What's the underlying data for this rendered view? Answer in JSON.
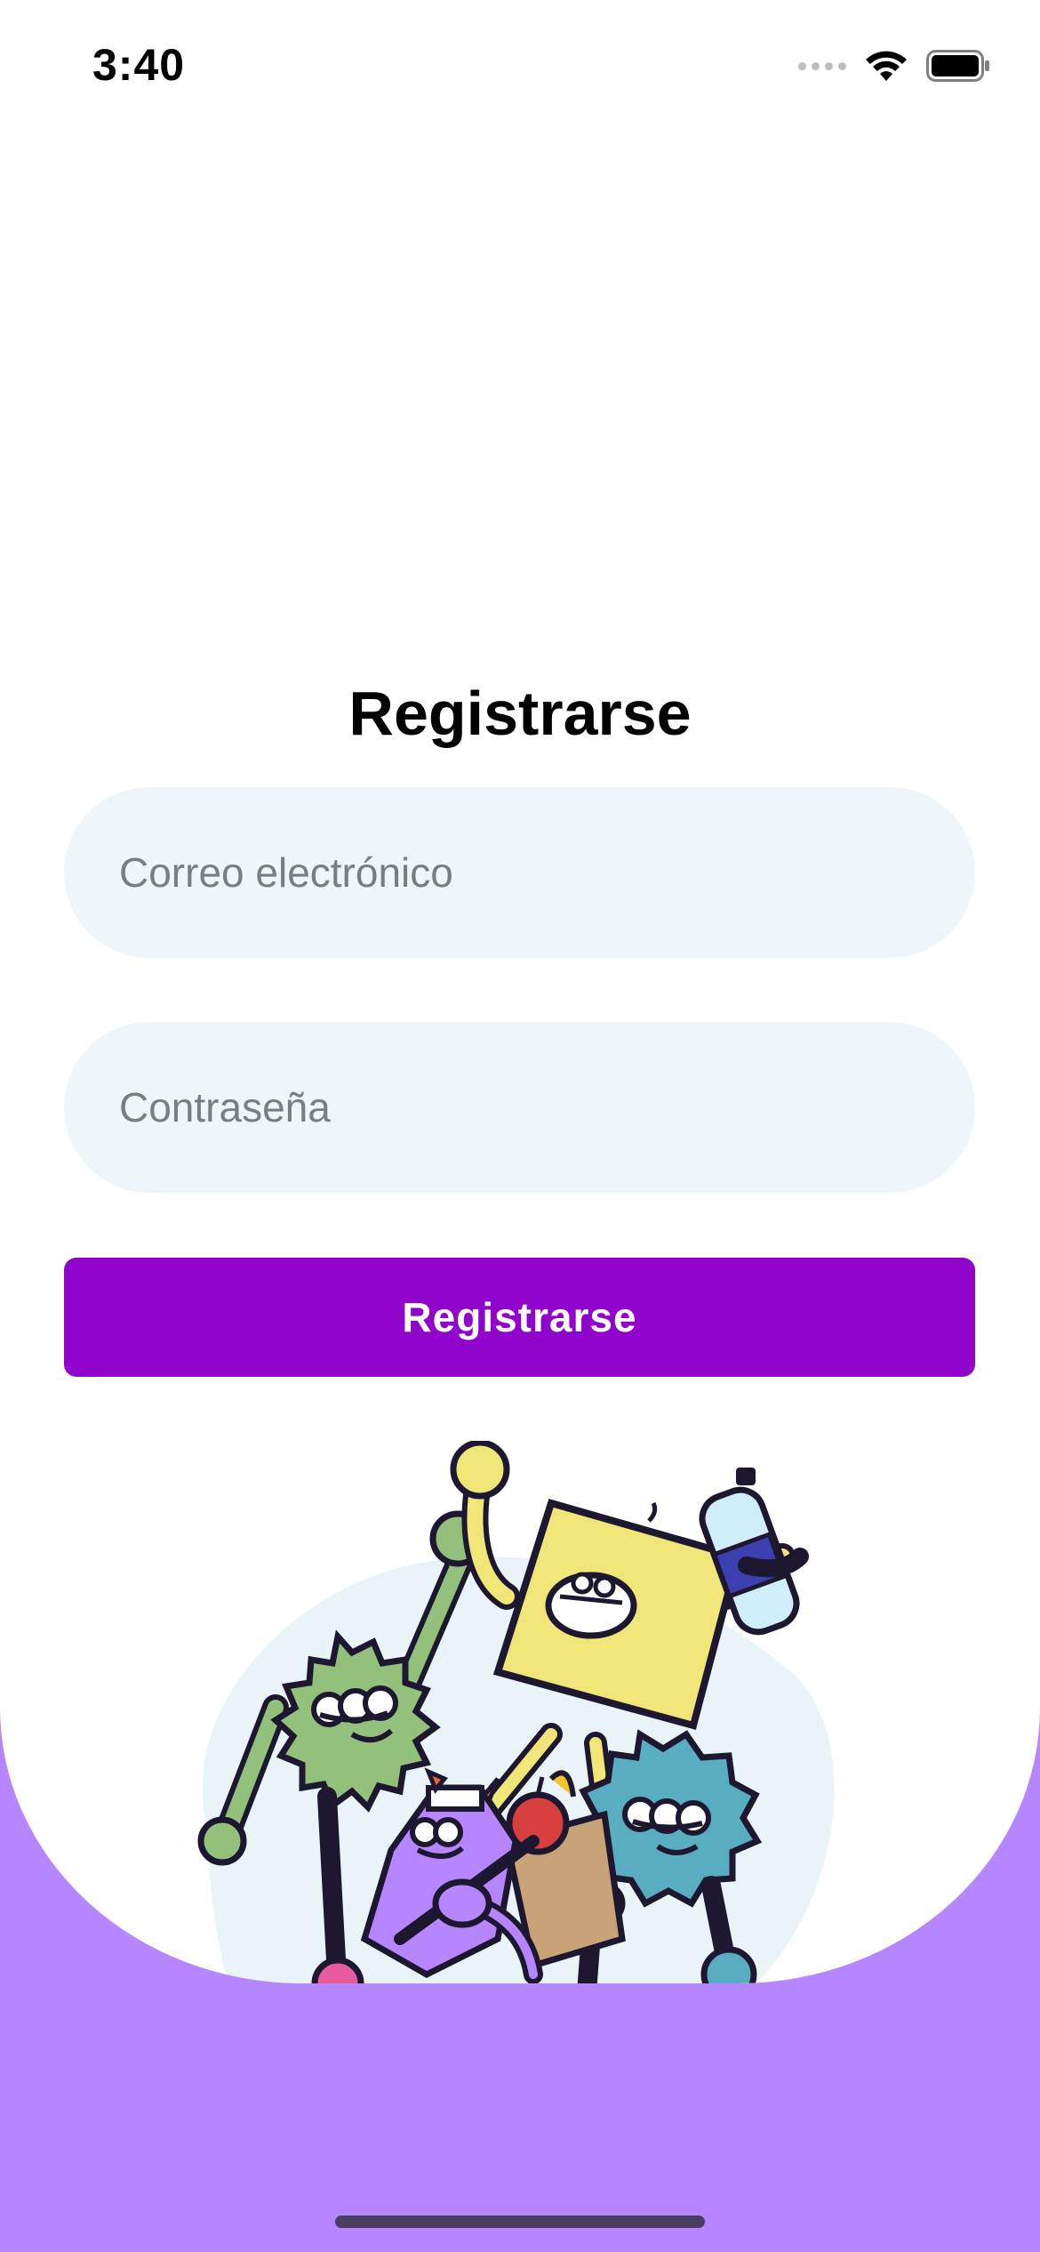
{
  "status_bar": {
    "time": "3:40"
  },
  "signup": {
    "title": "Registrarse",
    "email_placeholder": "Correo electrónico",
    "password_placeholder": "Contraseña",
    "submit_label": "Registrarse"
  },
  "illustration": {
    "name": "group-of-cartoon-characters"
  },
  "colors": {
    "accent": "#9104cc",
    "background_bottom": "#b586ff",
    "input_bg": "#eff5f9"
  }
}
